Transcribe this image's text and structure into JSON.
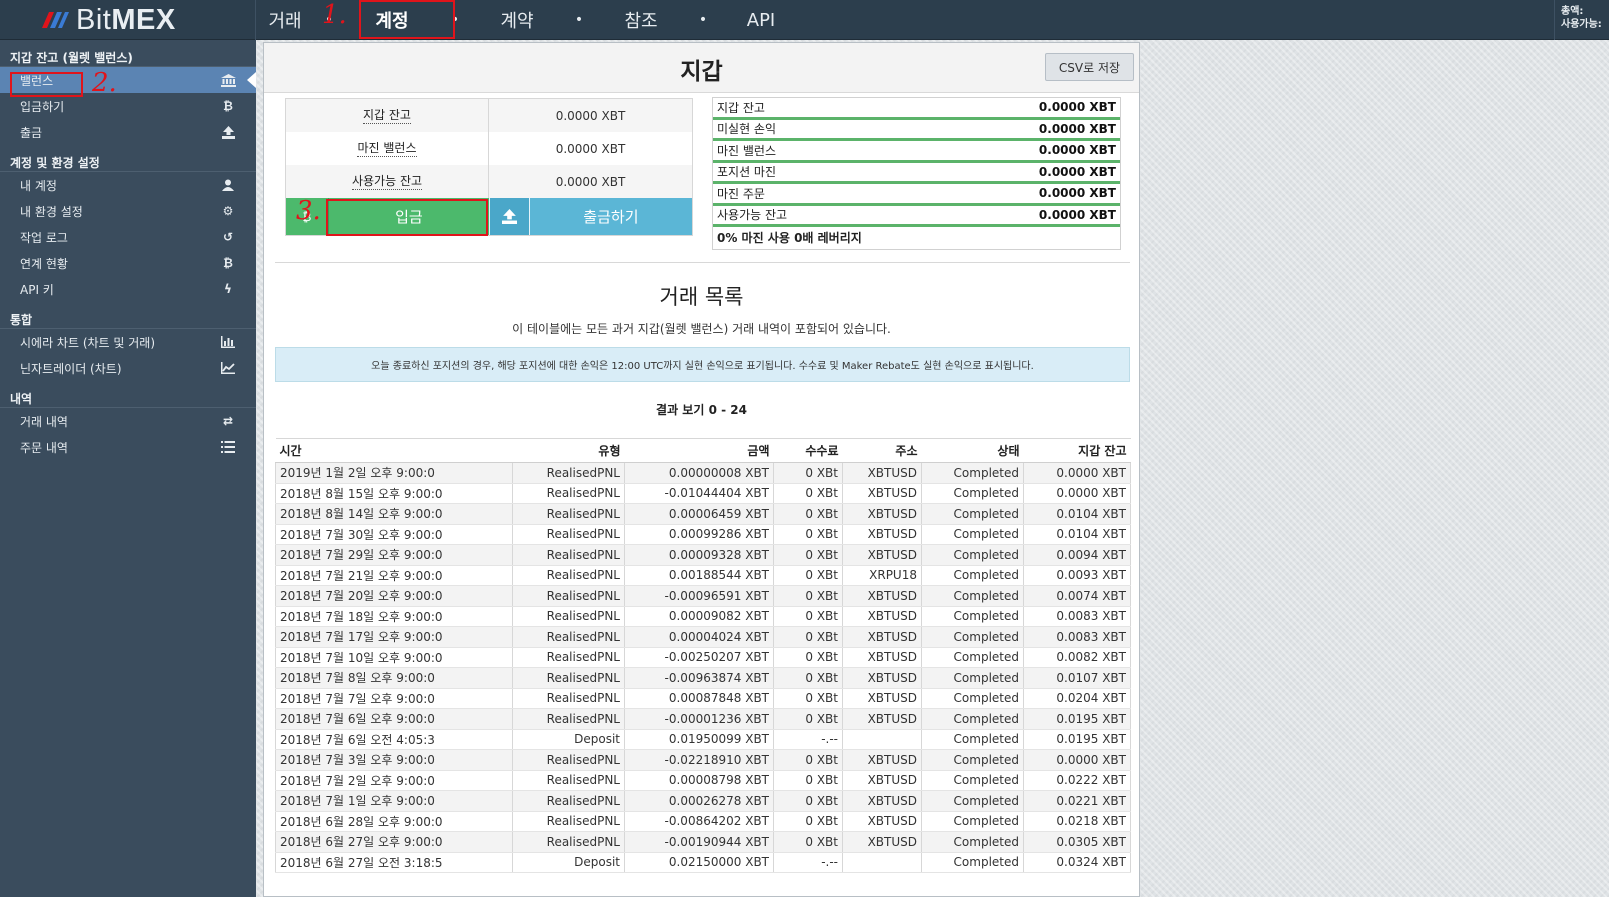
{
  "brand": {
    "name_light": "Bit",
    "name_bold": "MEX"
  },
  "topnav": {
    "items": [
      {
        "label": "거래",
        "active": false
      },
      {
        "label": "계정",
        "active": true
      },
      {
        "label": "계약",
        "active": false
      },
      {
        "label": "참조",
        "active": false
      },
      {
        "label": "API",
        "active": false
      }
    ],
    "right_line1": "총액:",
    "right_line2": "사용가능:"
  },
  "annotations": {
    "mark1": "1.",
    "mark2": "2.",
    "mark3": "3."
  },
  "sidebar": {
    "sections": [
      {
        "title": "지갑 잔고 (월렛 밸런스)",
        "items": [
          {
            "label": "밸런스",
            "icon": "bank-icon"
          },
          {
            "label": "입금하기",
            "icon": "bitcoin-icon"
          },
          {
            "label": "출금",
            "icon": "upload-icon"
          }
        ]
      },
      {
        "title": "계정 및 환경 설정",
        "items": [
          {
            "label": "내 계정",
            "icon": "user-icon"
          },
          {
            "label": "내 환경 설정",
            "icon": "gear-icon"
          },
          {
            "label": "작업 로그",
            "icon": "history-icon"
          },
          {
            "label": "연계 현황",
            "icon": "bitcoin-icon"
          },
          {
            "label": "API 키",
            "icon": "bolt-icon"
          }
        ]
      },
      {
        "title": "통합",
        "items": [
          {
            "label": "시에라 차트 (차트 및 거래)",
            "icon": "bar-chart-icon"
          },
          {
            "label": "닌자트레이더 (차트)",
            "icon": "line-chart-icon"
          }
        ]
      },
      {
        "title": "내역",
        "items": [
          {
            "label": "거래 내역",
            "icon": "exchange-icon"
          },
          {
            "label": "주문 내역",
            "icon": "list-icon"
          }
        ]
      }
    ]
  },
  "main": {
    "title": "지갑",
    "csv_button": "CSV로 저장",
    "balances_left": [
      {
        "label": "지갑 잔고",
        "value": "0.0000 XBT"
      },
      {
        "label": "마진 밸런스",
        "value": "0.0000 XBT"
      },
      {
        "label": "사용가능 잔고",
        "value": "0.0000 XBT"
      }
    ],
    "deposit_button": "입금",
    "withdraw_button": "출금하기",
    "balances_right": [
      {
        "label": "지갑 잔고",
        "value": "0.0000 XBT"
      },
      {
        "label": "미실현 손익",
        "value": "0.0000 XBT"
      },
      {
        "label": "마진 밸런스",
        "value": "0.0000 XBT"
      },
      {
        "label": "포지션 마진",
        "value": "0.0000 XBT"
      },
      {
        "label": "마진 주문",
        "value": "0.0000 XBT"
      },
      {
        "label": "사용가능 잔고",
        "value": "0.0000 XBT"
      }
    ],
    "leverage_text": "0% 마진 사용 0배 레버리지",
    "tx_title": "거래 목록",
    "tx_desc": "이 테이블에는 모든 과거 지갑(월렛 밸런스) 거래 내역이 포함되어 있습니다.",
    "info": "오늘 종료하신 포지션의 경우, 해당 포지션에 대한 손익은 12:00 UTC까지 실현 손익으로 표기됩니다. 수수료 및 Maker Rebate도 실현 손익으로 표시됩니다.",
    "results": "결과 보기 0 - 24",
    "columns": [
      "시간",
      "유형",
      "금액",
      "수수료",
      "주소",
      "상태",
      "지갑 잔고"
    ],
    "rows": [
      [
        "2019년 1월 2일 오후 9:00:0",
        "RealisedPNL",
        "0.00000008 XBT",
        "0 XBt",
        "XBTUSD",
        "Completed",
        "0.0000 XBT"
      ],
      [
        "2018년 8월 15일 오후 9:00:0",
        "RealisedPNL",
        "-0.01044404 XBT",
        "0 XBt",
        "XBTUSD",
        "Completed",
        "0.0000 XBT"
      ],
      [
        "2018년 8월 14일 오후 9:00:0",
        "RealisedPNL",
        "0.00006459 XBT",
        "0 XBt",
        "XBTUSD",
        "Completed",
        "0.0104 XBT"
      ],
      [
        "2018년 7월 30일 오후 9:00:0",
        "RealisedPNL",
        "0.00099286 XBT",
        "0 XBt",
        "XBTUSD",
        "Completed",
        "0.0104 XBT"
      ],
      [
        "2018년 7월 29일 오후 9:00:0",
        "RealisedPNL",
        "0.00009328 XBT",
        "0 XBt",
        "XBTUSD",
        "Completed",
        "0.0094 XBT"
      ],
      [
        "2018년 7월 21일 오후 9:00:0",
        "RealisedPNL",
        "0.00188544 XBT",
        "0 XBt",
        "XRPU18",
        "Completed",
        "0.0093 XBT"
      ],
      [
        "2018년 7월 20일 오후 9:00:0",
        "RealisedPNL",
        "-0.00096591 XBT",
        "0 XBt",
        "XBTUSD",
        "Completed",
        "0.0074 XBT"
      ],
      [
        "2018년 7월 18일 오후 9:00:0",
        "RealisedPNL",
        "0.00009082 XBT",
        "0 XBt",
        "XBTUSD",
        "Completed",
        "0.0083 XBT"
      ],
      [
        "2018년 7월 17일 오후 9:00:0",
        "RealisedPNL",
        "0.00004024 XBT",
        "0 XBt",
        "XBTUSD",
        "Completed",
        "0.0083 XBT"
      ],
      [
        "2018년 7월 10일 오후 9:00:0",
        "RealisedPNL",
        "-0.00250207 XBT",
        "0 XBt",
        "XBTUSD",
        "Completed",
        "0.0082 XBT"
      ],
      [
        "2018년 7월 8일 오후 9:00:0",
        "RealisedPNL",
        "-0.00963874 XBT",
        "0 XBt",
        "XBTUSD",
        "Completed",
        "0.0107 XBT"
      ],
      [
        "2018년 7월 7일 오후 9:00:0",
        "RealisedPNL",
        "0.00087848 XBT",
        "0 XBt",
        "XBTUSD",
        "Completed",
        "0.0204 XBT"
      ],
      [
        "2018년 7월 6일 오후 9:00:0",
        "RealisedPNL",
        "-0.00001236 XBT",
        "0 XBt",
        "XBTUSD",
        "Completed",
        "0.0195 XBT"
      ],
      [
        "2018년 7월 6일 오전 4:05:3",
        "Deposit",
        "0.01950099 XBT",
        "-.--",
        "",
        "Completed",
        "0.0195 XBT"
      ],
      [
        "2018년 7월 3일 오후 9:00:0",
        "RealisedPNL",
        "-0.02218910 XBT",
        "0 XBt",
        "XBTUSD",
        "Completed",
        "0.0000 XBT"
      ],
      [
        "2018년 7월 2일 오후 9:00:0",
        "RealisedPNL",
        "0.00008798 XBT",
        "0 XBt",
        "XBTUSD",
        "Completed",
        "0.0222 XBT"
      ],
      [
        "2018년 7월 1일 오후 9:00:0",
        "RealisedPNL",
        "0.00026278 XBT",
        "0 XBt",
        "XBTUSD",
        "Completed",
        "0.0221 XBT"
      ],
      [
        "2018년 6월 28일 오후 9:00:0",
        "RealisedPNL",
        "-0.00864202 XBT",
        "0 XBt",
        "XBTUSD",
        "Completed",
        "0.0218 XBT"
      ],
      [
        "2018년 6월 27일 오후 9:00:0",
        "RealisedPNL",
        "-0.00190944 XBT",
        "0 XBt",
        "XBTUSD",
        "Completed",
        "0.0305 XBT"
      ],
      [
        "2018년 6월 27일 오전 3:18:5",
        "Deposit",
        "0.02150000 XBT",
        "-.--",
        "",
        "Completed",
        "0.0324 XBT"
      ]
    ]
  },
  "colors": {
    "topbar": "#2c3e4d",
    "sidebar": "#3a4c5d",
    "active_item": "#5b84b3",
    "deposit_green": "#4cb96c",
    "withdraw_blue": "#5bb6d6",
    "annotation_red": "#e0141b"
  }
}
